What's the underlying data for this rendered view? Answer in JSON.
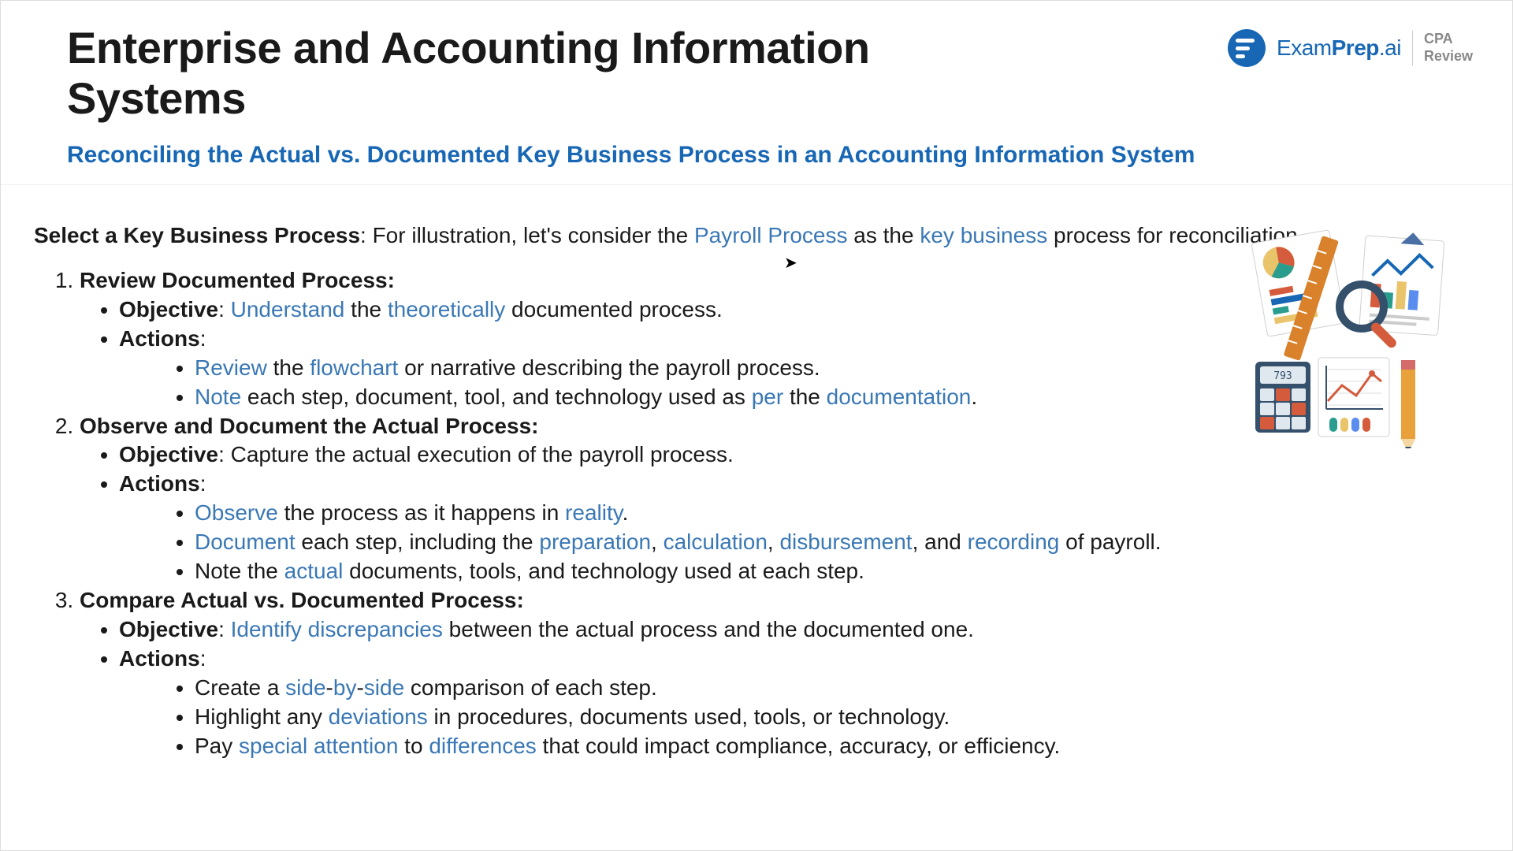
{
  "header": {
    "title": "Enterprise and Accounting Information Systems",
    "subtitle": "Reconciling the Actual vs. Documented Key Business Process in an Accounting Information System"
  },
  "logo": {
    "brand_prefix": "Exam",
    "brand_bold": "Prep",
    "brand_suffix": ".ai",
    "tag_line1": "CPA",
    "tag_line2": "Review"
  },
  "intro": {
    "lead_bold": "Select a Key Business Process",
    "lead_after": ": For illustration, let's consider the ",
    "hl1": "Payroll Process",
    "mid1": " as the ",
    "hl2": "key business",
    "tail": " process for reconciliation."
  },
  "steps": [
    {
      "title": "Review Documented Process:",
      "objective": {
        "label": "Objective",
        "pre": ": ",
        "hl1": "Understand",
        "mid1": " the ",
        "hl2": "theoretically",
        "tail": " documented process."
      },
      "actions_label": "Actions",
      "actions": [
        {
          "hl1": "Review",
          "mid1": " the ",
          "hl2": "flowchart",
          "tail": " or narrative describing the payroll process."
        },
        {
          "hl1": "Note",
          "mid1": " each step, document, tool, and technology used as ",
          "hl2": "per",
          "mid2": " the ",
          "hl3": "documentation",
          "tail": "."
        }
      ]
    },
    {
      "title": "Observe and Document the Actual Process:",
      "objective": {
        "label": "Objective",
        "pre": ": Capture the actual execution of the payroll process."
      },
      "actions_label": "Actions",
      "actions": [
        {
          "hl1": "Observe",
          "mid1": " the process as it happens in ",
          "hl2": "reality",
          "tail": "."
        },
        {
          "hl1": "Document",
          "mid1": " each step, including the ",
          "hl2": "preparation",
          "mid2": ", ",
          "hl3": "calculation",
          "mid3": ", ",
          "hl4": "disbursement",
          "mid4": ", and ",
          "hl5": "recording",
          "tail": " of payroll."
        },
        {
          "pre": "Note the ",
          "hl1": "actual",
          "tail": " documents, tools, and technology used at each step."
        }
      ]
    },
    {
      "title": "Compare Actual vs. Documented Process:",
      "objective": {
        "label": "Objective",
        "pre": ": ",
        "hl1": "Identify discrepancies",
        "tail": " between the actual process and the documented one."
      },
      "actions_label": "Actions",
      "actions": [
        {
          "pre": "Create a ",
          "hl1": "side",
          "mid1": "-",
          "hl2": "by",
          "mid2": "-",
          "hl3": "side",
          "tail": " comparison of each step."
        },
        {
          "pre": "Highlight any ",
          "hl1": "deviations",
          "tail": " in procedures, documents used, tools, or technology."
        },
        {
          "pre": "Pay ",
          "hl1": "special attention",
          "mid1": " to ",
          "hl2": "differences",
          "tail": " that could impact compliance, accuracy, or efficiency."
        }
      ]
    }
  ]
}
